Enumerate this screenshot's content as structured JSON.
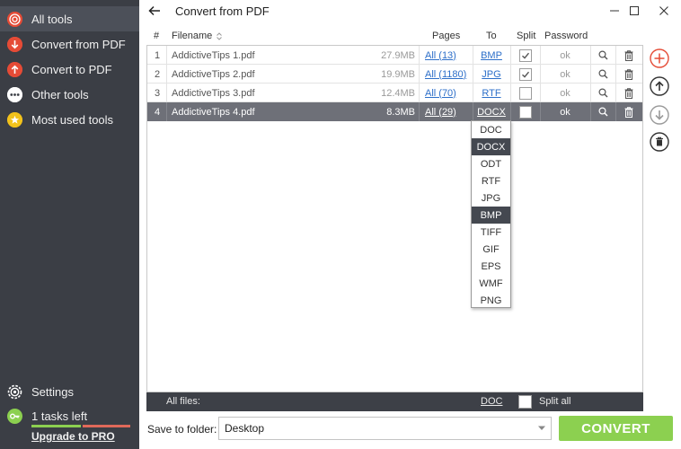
{
  "sidebar": {
    "items": [
      {
        "label": "All tools",
        "icon": "target-icon"
      },
      {
        "label": "Convert from PDF",
        "icon": "arrow-down-circle-icon"
      },
      {
        "label": "Convert to PDF",
        "icon": "arrow-up-circle-icon"
      },
      {
        "label": "Other tools",
        "icon": "more-dots-icon"
      },
      {
        "label": "Most used tools",
        "icon": "star-icon"
      }
    ],
    "settings_label": "Settings",
    "tasks_label": "1 tasks left",
    "upgrade_label": "Upgrade to PRO"
  },
  "header": {
    "title": "Convert from PDF"
  },
  "table": {
    "columns": {
      "num": "#",
      "filename": "Filename",
      "pages": "Pages",
      "to": "To",
      "split": "Split",
      "password": "Password"
    },
    "rows": [
      {
        "num": "1",
        "filename": "AddictiveTips 1.pdf",
        "size": "27.9MB",
        "pages": "All (13)",
        "to": "BMP",
        "split": true,
        "password": "ok"
      },
      {
        "num": "2",
        "filename": "AddictiveTips 2.pdf",
        "size": "19.9MB",
        "pages": "All (1180)",
        "to": "JPG",
        "split": true,
        "password": "ok"
      },
      {
        "num": "3",
        "filename": "AddictiveTips 3.pdf",
        "size": "12.4MB",
        "pages": "All (70)",
        "to": "RTF",
        "split": false,
        "password": "ok"
      },
      {
        "num": "4",
        "filename": "AddictiveTips 4.pdf",
        "size": "8.3MB",
        "pages": "All (29)",
        "to": "DOCX",
        "split": false,
        "password": "ok"
      }
    ],
    "selected_row": 4
  },
  "format_dropdown": {
    "options": [
      "DOC",
      "DOCX",
      "ODT",
      "RTF",
      "JPG",
      "BMP",
      "TIFF",
      "GIF",
      "EPS",
      "WMF",
      "PNG"
    ],
    "selected": "DOCX",
    "hovered": "BMP"
  },
  "footer": {
    "all_files_label": "All files:",
    "all_format": "DOC",
    "split_all_label": "Split all"
  },
  "bottom": {
    "save_label": "Save to folder:",
    "folder_value": "Desktop",
    "convert_label": "CONVERT"
  },
  "colors": {
    "sidebar_bg": "#3b3e45",
    "accent_red": "#e54b36",
    "convert_green": "#8cd050",
    "link_blue": "#2d6fc9"
  }
}
